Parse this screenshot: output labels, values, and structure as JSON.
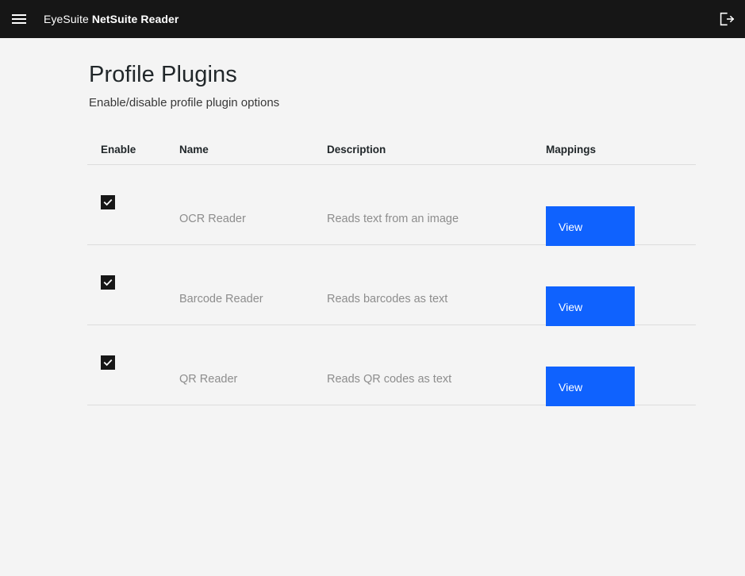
{
  "header": {
    "menu_icon": "hamburger-menu-icon",
    "brand_prefix": "EyeSuite ",
    "brand_strong": "NetSuite Reader",
    "logout_icon": "logout-icon"
  },
  "page": {
    "title": "Profile Plugins",
    "subtitle": "Enable/disable profile plugin options"
  },
  "table": {
    "columns": {
      "enable": "Enable",
      "name": "Name",
      "description": "Description",
      "mappings": "Mappings"
    },
    "rows": [
      {
        "enabled": true,
        "name": "OCR Reader",
        "description": "Reads text from an image",
        "action_label": "View"
      },
      {
        "enabled": true,
        "name": "Barcode Reader",
        "description": "Reads barcodes as text",
        "action_label": "View"
      },
      {
        "enabled": true,
        "name": "QR Reader",
        "description": "Reads QR codes as text",
        "action_label": "View"
      }
    ]
  },
  "colors": {
    "header_bg": "#161616",
    "page_bg": "#f4f4f4",
    "accent_blue": "#0f62fe",
    "checkbox_fill": "#171717",
    "divider": "#dcdcdc",
    "title_text": "#21272a",
    "muted_text": "#8d8d8d"
  }
}
